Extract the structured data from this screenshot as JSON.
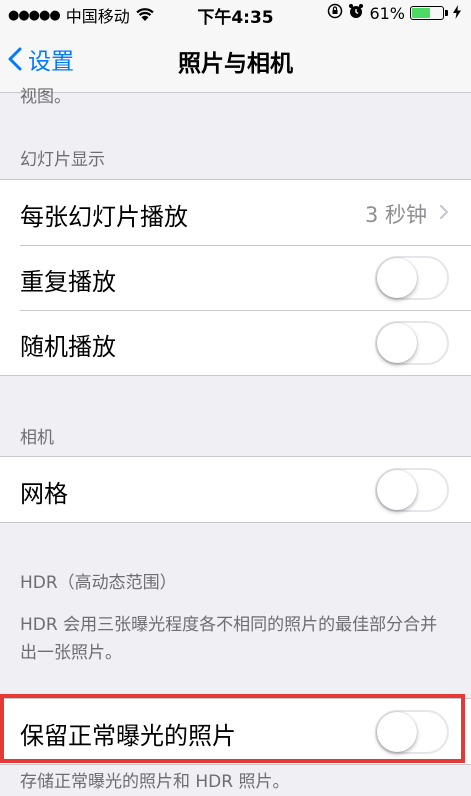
{
  "status_bar": {
    "signal": "●●●●●",
    "carrier": "中国移动",
    "time": "下午4:35",
    "battery_percent": "61%",
    "battery_level": 0.61
  },
  "nav": {
    "back_label": "设置",
    "title": "照片与相机"
  },
  "clipped_text": "视图。",
  "slideshow": {
    "header": "幻灯片显示",
    "rows": [
      {
        "label": "每张幻灯片播放",
        "value": "3 秒钟"
      },
      {
        "label": "重复播放",
        "toggle": false
      },
      {
        "label": "随机播放",
        "toggle": false
      }
    ]
  },
  "camera": {
    "header": "相机",
    "rows": [
      {
        "label": "网格",
        "toggle": false
      }
    ]
  },
  "hdr": {
    "header": "HDR（高动态范围）",
    "description": "HDR 会用三张曝光程度各不相同的照片的最佳部分合并出一张照片。",
    "rows": [
      {
        "label": "保留正常曝光的照片",
        "toggle": false
      }
    ],
    "footer": "存储正常曝光的照片和 HDR 照片。"
  },
  "colors": {
    "accent": "#007aff",
    "highlight": "#e53935",
    "battery": "#4cd964"
  }
}
